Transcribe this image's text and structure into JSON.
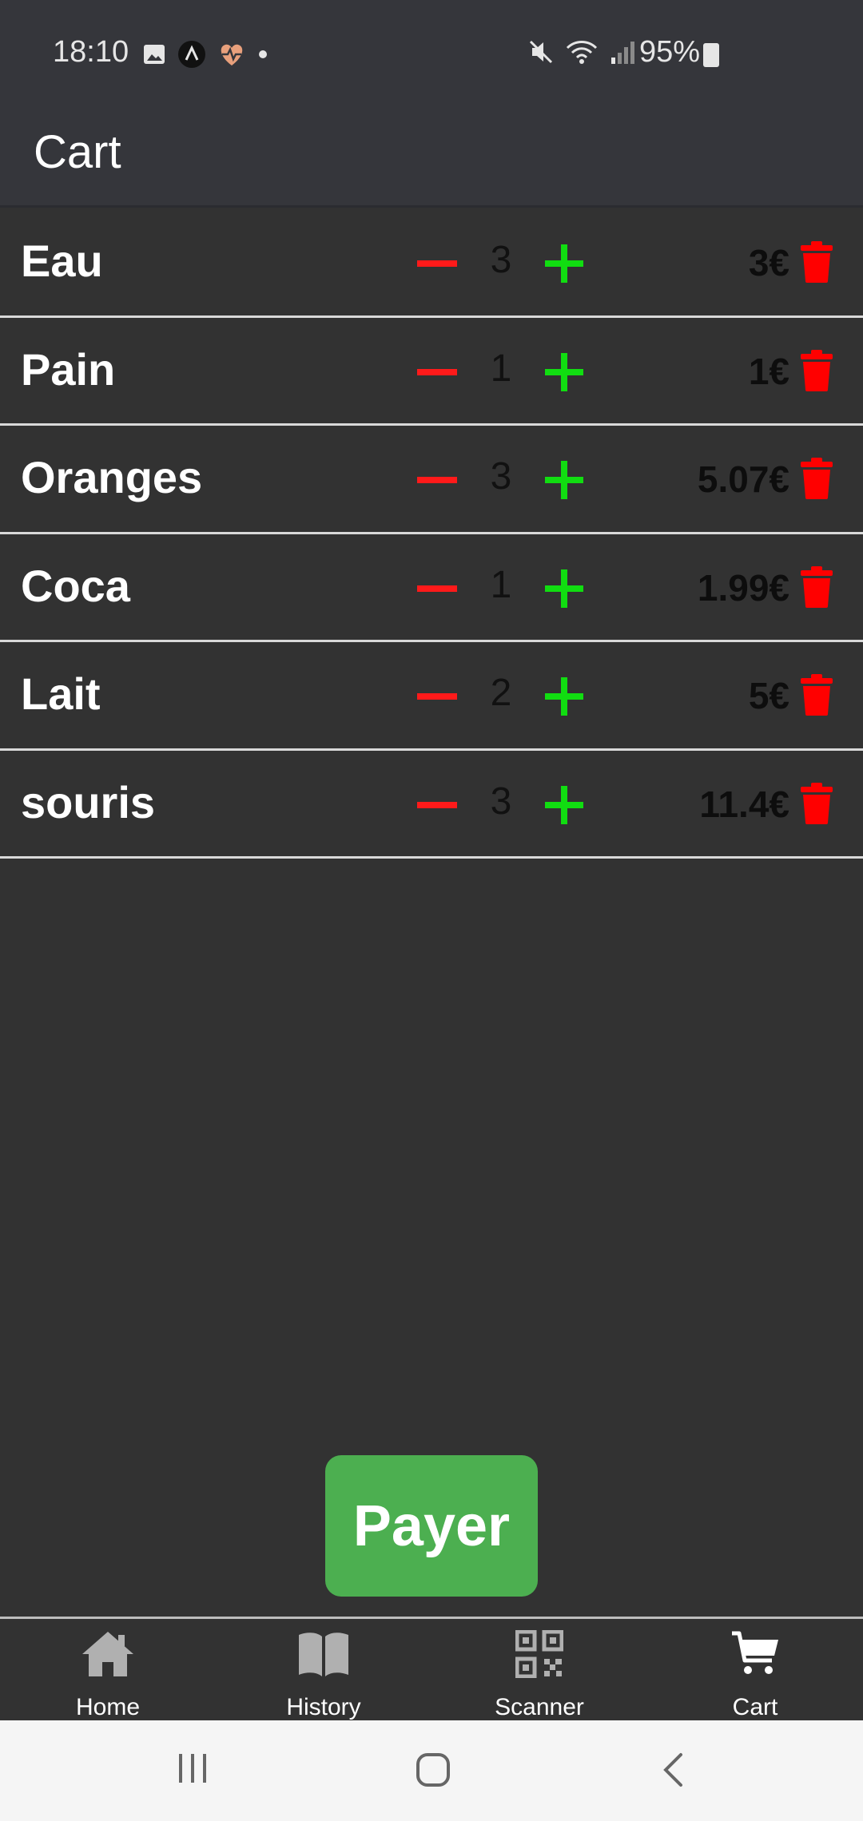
{
  "status_bar": {
    "time": "18:10",
    "battery": "95%"
  },
  "header": {
    "title": "Cart"
  },
  "cart": {
    "items": [
      {
        "name": "Eau",
        "quantity": "3",
        "price": "3€"
      },
      {
        "name": "Pain",
        "quantity": "1",
        "price": "1€"
      },
      {
        "name": "Oranges",
        "quantity": "3",
        "price": "5.07€"
      },
      {
        "name": "Coca",
        "quantity": "1",
        "price": "1.99€"
      },
      {
        "name": "Lait",
        "quantity": "2",
        "price": "5€"
      },
      {
        "name": "souris",
        "quantity": "3",
        "price": "11.4€"
      }
    ]
  },
  "pay_button": {
    "label": "Payer"
  },
  "bottom_nav": {
    "items": [
      {
        "label": "Home",
        "icon": "home-icon"
      },
      {
        "label": "History",
        "icon": "book-icon"
      },
      {
        "label": "Scanner",
        "icon": "qr-code-icon"
      },
      {
        "label": "Cart",
        "icon": "cart-icon"
      }
    ]
  },
  "colors": {
    "background": "#323232",
    "minus": "#ff1a1a",
    "plus": "#11dd11",
    "trash": "#ff0000",
    "pay_button": "#4caf50"
  }
}
